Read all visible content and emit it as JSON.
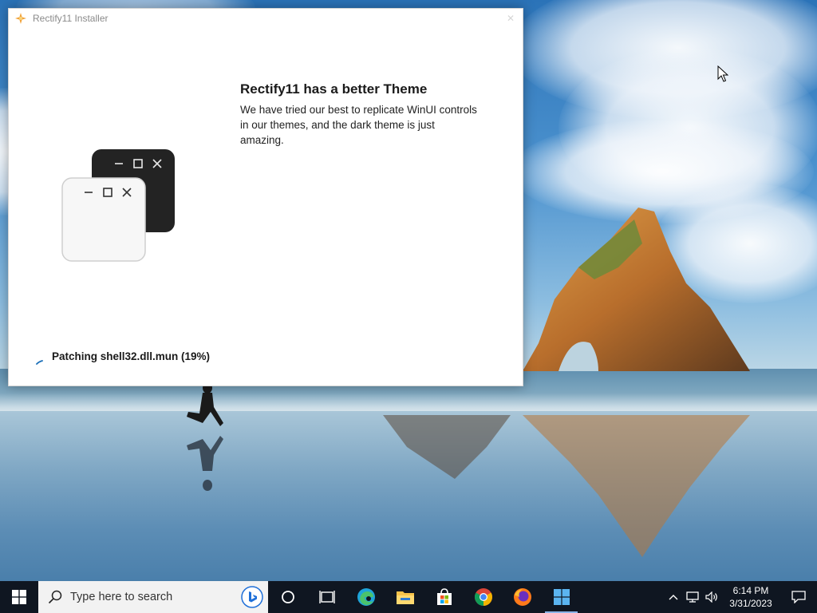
{
  "window": {
    "title": "Rectify11 Installer",
    "close_glyph": "✕",
    "heading": "Rectify11 has a better Theme",
    "description": "We have tried our best to replicate WinUI controls in our themes, and the dark theme is just amazing.",
    "status": "Patching shell32.dll.mun (19%)",
    "progress_percent": 19
  },
  "taskbar": {
    "search_placeholder": "Type here to search",
    "apps": [
      "task-view",
      "edge",
      "file-explorer",
      "microsoft-store",
      "chrome",
      "firefox",
      "rectify11-installer"
    ],
    "clock_time": "6:14 PM",
    "clock_date": "3/31/2023"
  },
  "colors": {
    "taskbar_bg": "#0f1621",
    "start_blue": "#ffffff",
    "accent": "#0078d4"
  }
}
